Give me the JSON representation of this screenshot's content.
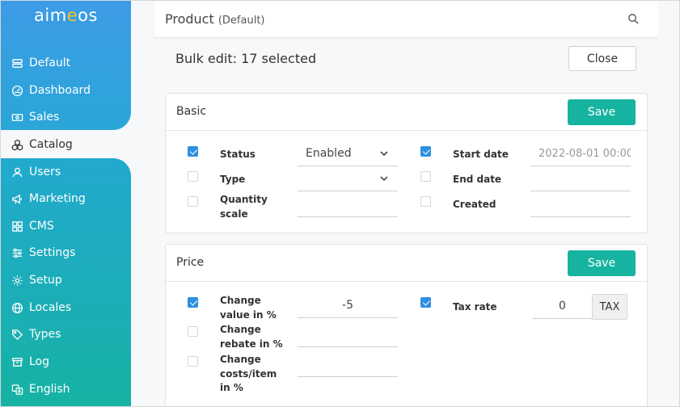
{
  "app": {
    "logo_prefix": "aim",
    "logo_accent": "e",
    "logo_suffix": "os"
  },
  "sidebar": {
    "items": [
      {
        "label": "Default",
        "icon": "server-icon"
      },
      {
        "label": "Dashboard",
        "icon": "gauge-icon"
      },
      {
        "label": "Sales",
        "icon": "cash-icon"
      },
      {
        "label": "Catalog",
        "icon": "boxes-icon",
        "active": true
      },
      {
        "label": "Users",
        "icon": "user-icon"
      },
      {
        "label": "Marketing",
        "icon": "megaphone-icon"
      },
      {
        "label": "CMS",
        "icon": "grid-icon"
      },
      {
        "label": "Settings",
        "icon": "sliders-icon"
      },
      {
        "label": "Setup",
        "icon": "gear-icon"
      },
      {
        "label": "Locales",
        "icon": "globe-icon"
      },
      {
        "label": "Types",
        "icon": "tags-icon"
      },
      {
        "label": "Log",
        "icon": "archive-icon"
      },
      {
        "label": "English",
        "icon": "translate-icon"
      }
    ]
  },
  "header": {
    "title": "Product",
    "subtitle": "(Default)"
  },
  "bulk": {
    "title": "Bulk edit: 17 selected",
    "close_label": "Close"
  },
  "basic": {
    "title": "Basic",
    "save_label": "Save",
    "status_label": "Status",
    "status_value": "Enabled",
    "type_label": "Type",
    "type_value": "",
    "quantity_label_1": "Quantity",
    "quantity_label_2": "scale",
    "quantity_value": "",
    "start_label": "Start date",
    "start_value": "2022-08-01 00:00",
    "end_label": "End date",
    "end_value": "",
    "created_label": "Created",
    "created_value": ""
  },
  "price": {
    "title": "Price",
    "save_label": "Save",
    "value_label_1": "Change",
    "value_label_2": "value in %",
    "value_value": "-5",
    "rebate_label_1": "Change",
    "rebate_label_2": "rebate in %",
    "rebate_value": "",
    "costs_label_1": "Change",
    "costs_label_2": "costs/item",
    "costs_label_3": "in %",
    "costs_value": "",
    "tax_label": "Tax rate",
    "tax_value": "0",
    "tax_addon": "TAX"
  },
  "colors": {
    "accent_green": "#16b4a0",
    "checkbox_blue": "#2f8fe3",
    "sidebar_top": "#3d9be6",
    "sidebar_bottom": "#16b2a3"
  }
}
